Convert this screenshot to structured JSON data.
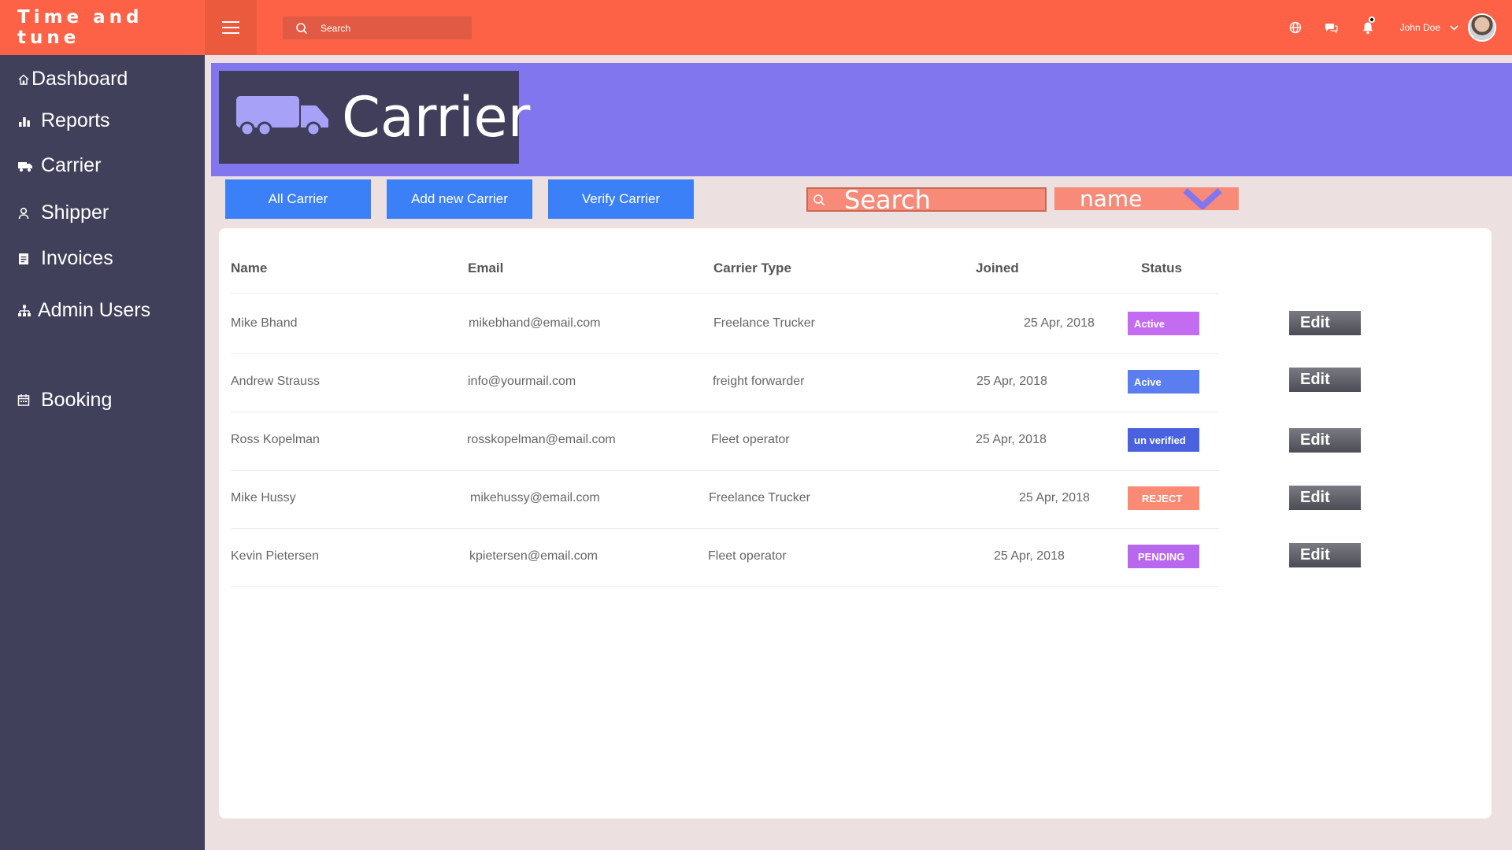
{
  "brand": "Time and tune",
  "topbar": {
    "search_placeholder": "Search",
    "user_name": "John Doe"
  },
  "sidebar": {
    "items": [
      {
        "label": "Dashboard",
        "icon": "home-icon"
      },
      {
        "label": "Reports",
        "icon": "bar-chart-icon"
      },
      {
        "label": "Carrier",
        "icon": "truck-icon"
      },
      {
        "label": "Shipper",
        "icon": "user-icon"
      },
      {
        "label": "Invoices",
        "icon": "invoice-icon"
      },
      {
        "label": "Admin Users",
        "icon": "sitemap-icon"
      },
      {
        "label": "Booking",
        "icon": "calendar-icon"
      }
    ]
  },
  "page": {
    "title": "Carrier",
    "buttons": [
      "All Carrier",
      "Add new Carrier",
      "Verify Carrier"
    ],
    "filter_search_placeholder": "Search",
    "filter_select_value": "name"
  },
  "table": {
    "headers": [
      "Name",
      "Email",
      "Carrier Type",
      "Joined",
      "Status"
    ],
    "rows": [
      {
        "name": "Mike Bhand",
        "email": "mikebhand@email.com",
        "type": "Freelance Trucker",
        "joined": "25 Apr, 2018",
        "status": "Active",
        "edit": "Edit"
      },
      {
        "name": "Andrew Strauss",
        "email": "info@yourmail.com",
        "type": "freight forwarder",
        "joined": "25 Apr, 2018",
        "status": "Acive",
        "edit": "Edit"
      },
      {
        "name": "Ross Kopelman",
        "email": "rosskopelman@email.com",
        "type": "Fleet operator",
        "joined": "25 Apr, 2018",
        "status": "un verified",
        "edit": "Edit"
      },
      {
        "name": "Mike Hussy",
        "email": "mikehussy@email.com",
        "type": "Freelance Trucker",
        "joined": "25 Apr, 2018",
        "status": "REJECT",
        "edit": "Edit"
      },
      {
        "name": "Kevin Pietersen",
        "email": "kpietersen@email.com",
        "type": "Fleet operator",
        "joined": "25 Apr, 2018",
        "status": "PENDING",
        "edit": "Edit"
      }
    ]
  },
  "colors": {
    "topbar": "#fd6246",
    "sidebar": "#40405a",
    "banner": "#8276ee",
    "button": "#3c80f7",
    "badge_active": "#c36cf2",
    "badge_acive": "#5a7ef0",
    "badge_unverified": "#4a62e0",
    "badge_reject": "#fb8a74",
    "badge_pending": "#b867ef"
  }
}
